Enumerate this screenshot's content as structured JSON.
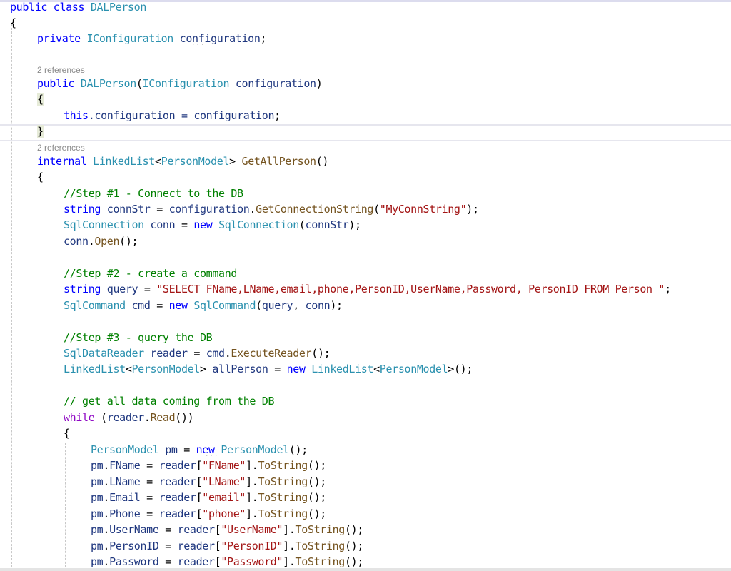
{
  "editor": {
    "codelens": [
      "2 references",
      "2 references"
    ],
    "lines": {
      "l1": [
        "public",
        "class",
        "DALPerson"
      ],
      "l2": "{",
      "l3": [
        "private",
        "IConfiguration",
        "configuration",
        ";"
      ],
      "l5": [
        "public",
        "DALPerson",
        "(",
        "IConfiguration",
        "configuration",
        ")"
      ],
      "l6": "{",
      "l7": [
        "this",
        ".configuration = ",
        "configuration",
        ";"
      ],
      "l8": "}",
      "l10": [
        "internal",
        "LinkedList",
        "<",
        "PersonModel",
        ">",
        "GetAllPerson",
        "()"
      ],
      "l11": "{",
      "l12": "//Step #1 - Connect to the DB",
      "l13": [
        "string",
        "connStr",
        " = ",
        "configuration",
        ".",
        "GetConnectionString",
        "(",
        "\"MyConnString\"",
        ");"
      ],
      "l14": [
        "SqlConnection",
        "conn",
        " = ",
        "new",
        "SqlConnection",
        "(",
        "connStr",
        ");"
      ],
      "l15": [
        "conn",
        ".",
        "Open",
        "();"
      ],
      "l17": "//Step #2 - create a command",
      "l18": [
        "string",
        "query",
        " = ",
        "\"SELECT FName,LName,email,phone,PersonID,UserName,Password, PersonID FROM Person \"",
        ";"
      ],
      "l19": [
        "SqlCommand",
        "cmd",
        " = ",
        "new",
        "SqlCommand",
        "(",
        "query",
        ", ",
        "conn",
        ");"
      ],
      "l21": "//Step #3 - query the DB",
      "l22": [
        "SqlDataReader",
        "reader",
        " = ",
        "cmd",
        ".",
        "ExecuteReader",
        "();"
      ],
      "l23": [
        "LinkedList",
        "<",
        "PersonModel",
        ">",
        "allPerson",
        " = ",
        "new",
        "LinkedList",
        "<",
        "PersonModel",
        ">();"
      ],
      "l25": "// get all data coming from the DB",
      "l26": [
        "while",
        " (",
        "reader",
        ".",
        "Read",
        "())"
      ],
      "l27": "{",
      "l28": [
        "PersonModel",
        "pm",
        " = ",
        "new",
        "PersonModel",
        "();"
      ],
      "assignments": [
        {
          "prop": "FName",
          "key": "\"FName\""
        },
        {
          "prop": "LName",
          "key": "\"LName\""
        },
        {
          "prop": "Email",
          "key": "\"email\""
        },
        {
          "prop": "Phone",
          "key": "\"phone\""
        },
        {
          "prop": "UserName",
          "key": "\"UserName\""
        },
        {
          "prop": "PersonID",
          "key": "\"PersonID\""
        },
        {
          "prop": "Password",
          "key": "\"Password\""
        }
      ],
      "assign_parts": [
        "pm",
        ".",
        " = ",
        "reader",
        "[",
        "].",
        "ToString",
        "();"
      ]
    }
  }
}
